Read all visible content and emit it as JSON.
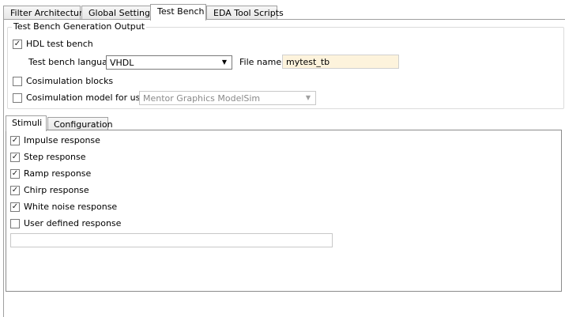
{
  "tabs": [
    "Filter Architecture",
    "Global Settings",
    "Test Bench",
    "EDA Tool Scripts"
  ],
  "active_tab": "Test Bench",
  "group": {
    "title": "Test Bench Generation Output",
    "hdl_test_bench": {
      "label": "HDL test bench",
      "checked": true
    },
    "language_label": "Test bench language:",
    "language_value": "VHDL",
    "file_name_label": "File name:",
    "file_name_value": "mytest_tb",
    "cosim_blocks": {
      "label": "Cosimulation blocks",
      "checked": false
    },
    "cosim_model": {
      "label": "Cosimulation model for use with:",
      "checked": false
    },
    "cosim_tool_value": "Mentor Graphics ModelSim"
  },
  "subtabs": [
    "Stimuli",
    "Configuration"
  ],
  "active_subtab": "Stimuli",
  "stimuli": [
    {
      "label": "Impulse response",
      "checked": true
    },
    {
      "label": "Step response",
      "checked": true
    },
    {
      "label": "Ramp response",
      "checked": true
    },
    {
      "label": "Chirp response",
      "checked": true
    },
    {
      "label": "White noise response",
      "checked": true
    },
    {
      "label": "User defined response",
      "checked": false
    }
  ],
  "user_defined_value": ""
}
